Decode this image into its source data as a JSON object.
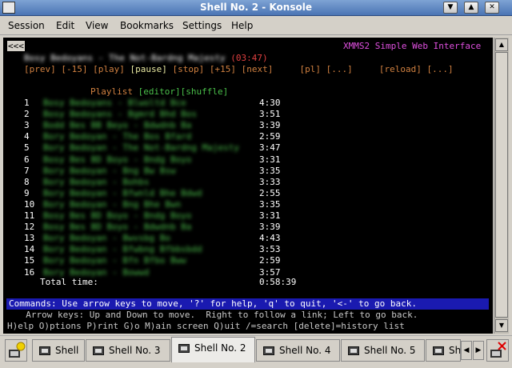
{
  "window": {
    "title": "Shell No. 2 - Konsole"
  },
  "menubar": {
    "items": [
      "Session",
      "Edit",
      "View",
      "Bookmarks",
      "Settings",
      "Help"
    ]
  },
  "terminal": {
    "back_link": "<<<",
    "app_title": "XMMS2 Simple Web Interface",
    "now_playing": {
      "track": "Bosy Bedoyans - The Not-Bardng Majesty",
      "time": "(03:47)"
    },
    "controls": {
      "prev": "[prev]",
      "back15": "[-15]",
      "play": "[play]",
      "pause": "[pause]",
      "stop": "[stop]",
      "fwd15": "[+15]",
      "next": "[next]",
      "pl": "[pl]",
      "dots1": "[...]",
      "reload": "[reload]",
      "dots2": "[...]"
    },
    "playlist_header": {
      "label": "Playlist",
      "editor": "[editor]",
      "shuffle": "[shuffle]"
    },
    "playlist": [
      {
        "num": "1",
        "title": "Bosy Bedoyans - Blwoltd Bce",
        "time": "4:30"
      },
      {
        "num": "2",
        "title": "Bosy Bedoyans - Bgmrd Bhd Bos",
        "time": "3:51"
      },
      {
        "num": "3",
        "title": "Bodd Bes BB Beyo - Bdwdnb Ba",
        "time": "3:39"
      },
      {
        "num": "4",
        "title": "Bory Bedoyan - The Bos Bfard",
        "time": "2:59"
      },
      {
        "num": "5",
        "title": "Bory Bedoyan - The Not-Bardng Majesty",
        "time": "3:47"
      },
      {
        "num": "6",
        "title": "Bosy Bes BD Boyo - Bndg Boyo",
        "time": "3:31"
      },
      {
        "num": "7",
        "title": "Bory Bedoyan - Bng Bw Bsw",
        "time": "3:35"
      },
      {
        "num": "8",
        "title": "Bory Bedoyan - Bohbs",
        "time": "3:33"
      },
      {
        "num": "9",
        "title": "Bory Bedoyan - Bfwnld Bhe Bdwd",
        "time": "2:55"
      },
      {
        "num": "10",
        "title": "Bory Bedoyan - Bng Bhe Bwn",
        "time": "3:35"
      },
      {
        "num": "11",
        "title": "Bosy Bes BD Boyo - Bndg Boyo",
        "time": "3:31"
      },
      {
        "num": "12",
        "title": "Bosy Bes BD Boyo - Bdwdnb Ba",
        "time": "3:39"
      },
      {
        "num": "13",
        "title": "Bory Bedoyan - Bwvsbg Bo",
        "time": "4:43"
      },
      {
        "num": "14",
        "title": "Bory Bedoyan - Bfwbng Bfbbsbdd",
        "time": "3:53"
      },
      {
        "num": "15",
        "title": "Bory Bedoyan - Bfn Bfbo Bww",
        "time": "2:59"
      },
      {
        "num": "16",
        "title": "Bory Bedoyan - Bowwd",
        "time": "3:57"
      }
    ],
    "total": {
      "label": "Total time:",
      "time": "0:58:39"
    },
    "command_bar": "Commands: Use arrow keys to move, '?' for help, 'q' to quit, '<-' to go back.",
    "help_line1": "  Arrow keys: Up and Down to move.  Right to follow a link; Left to go back.",
    "help_line2": "H)elp O)ptions P)rint G)o M)ain screen Q)uit /=search [delete]=history list"
  },
  "tabs": [
    "Shell",
    "Shell No. 3",
    "Shell No. 2",
    "Shell No. 4",
    "Shell No. 5",
    "Sh"
  ],
  "active_tab": "Shell No. 2"
}
